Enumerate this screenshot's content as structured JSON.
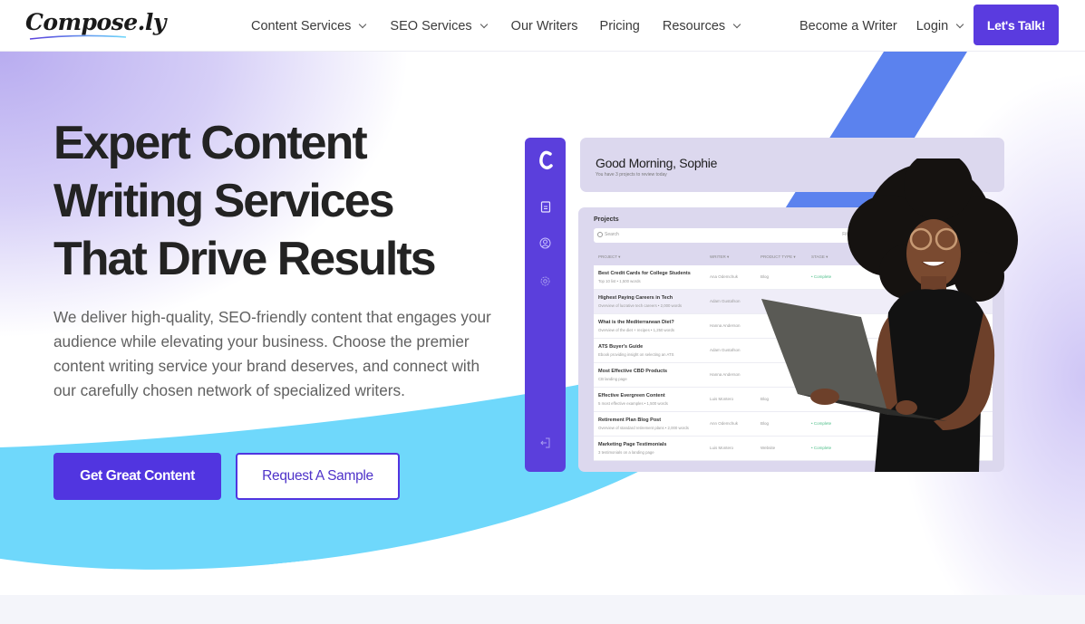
{
  "header": {
    "logo_text": "Compose.ly",
    "nav": [
      {
        "label": "Content Services",
        "has_dropdown": true
      },
      {
        "label": "SEO Services",
        "has_dropdown": true
      },
      {
        "label": "Our Writers",
        "has_dropdown": false
      },
      {
        "label": "Pricing",
        "has_dropdown": false
      },
      {
        "label": "Resources",
        "has_dropdown": true
      }
    ],
    "become_writer": "Become a Writer",
    "login": "Login",
    "cta": "Let's Talk!"
  },
  "hero": {
    "title_lines": [
      "Expert Content",
      "Writing Services",
      "That Drive Results"
    ],
    "description": "We deliver high-quality, SEO-friendly content that engages your audience while elevating your business. Choose the premier content writing service your brand deserves, and connect with our carefully chosen network of specialized writers.",
    "primary_button": "Get Great Content",
    "secondary_button": "Request A Sample"
  },
  "dashboard_mock": {
    "greeting": "Good Morning, Sophie",
    "greeting_sub": "You have 3 projects to review today",
    "projects_title": "Projects",
    "search_placeholder": "Search",
    "filter_label": "Filter by",
    "columns": [
      "PROJECT ▾",
      "WRITER ▾",
      "PRODUCT TYPE ▾",
      "STAGE ▾"
    ],
    "rows": [
      {
        "title": "Best Credit Cards for College Students",
        "sub": "Top 10 list • 1,500 words",
        "writer": "Ana Odemchuk",
        "type": "Blog",
        "status": "• Complete"
      },
      {
        "title": "Highest Paying Careers in Tech",
        "sub": "Overview of lucrative tech careers • 2,000 words",
        "writer": "Adam Gustafson",
        "type": "",
        "status": ""
      },
      {
        "title": "What is the Mediterranean Diet?",
        "sub": "Overview of the diet + recipes • 1,250 words",
        "writer": "Hanna Anderson",
        "type": "",
        "status": ""
      },
      {
        "title": "ATS Buyer's Guide",
        "sub": "Ebook providing insight on selecting an ATS",
        "writer": "Adam Gustafson",
        "type": "",
        "status": ""
      },
      {
        "title": "Most Effective CBD Products",
        "sub": "CB landing page",
        "writer": "Hanna Anderson",
        "type": "",
        "status": ""
      },
      {
        "title": "Effective Evergreen Content",
        "sub": "5 most effective examples • 1,500 words",
        "writer": "Luis Montero",
        "type": "Blog",
        "status": ""
      },
      {
        "title": "Retirement Plan Blog Post",
        "sub": "Overview of standard retirement plans • 2,000 words",
        "writer": "Ann Odemchuk",
        "type": "Blog",
        "status": "• Complete"
      },
      {
        "title": "Marketing Page Testimonials",
        "sub": "3 testimonials on a landing page",
        "writer": "Luis Montero",
        "type": "Website",
        "status": "• Complete"
      }
    ]
  },
  "colors": {
    "brand_purple": "#5135e0",
    "cyan_accent": "#6fd8fb",
    "blue_stripe": "#5b82ee",
    "mock_panel": "#dcd8ee"
  }
}
